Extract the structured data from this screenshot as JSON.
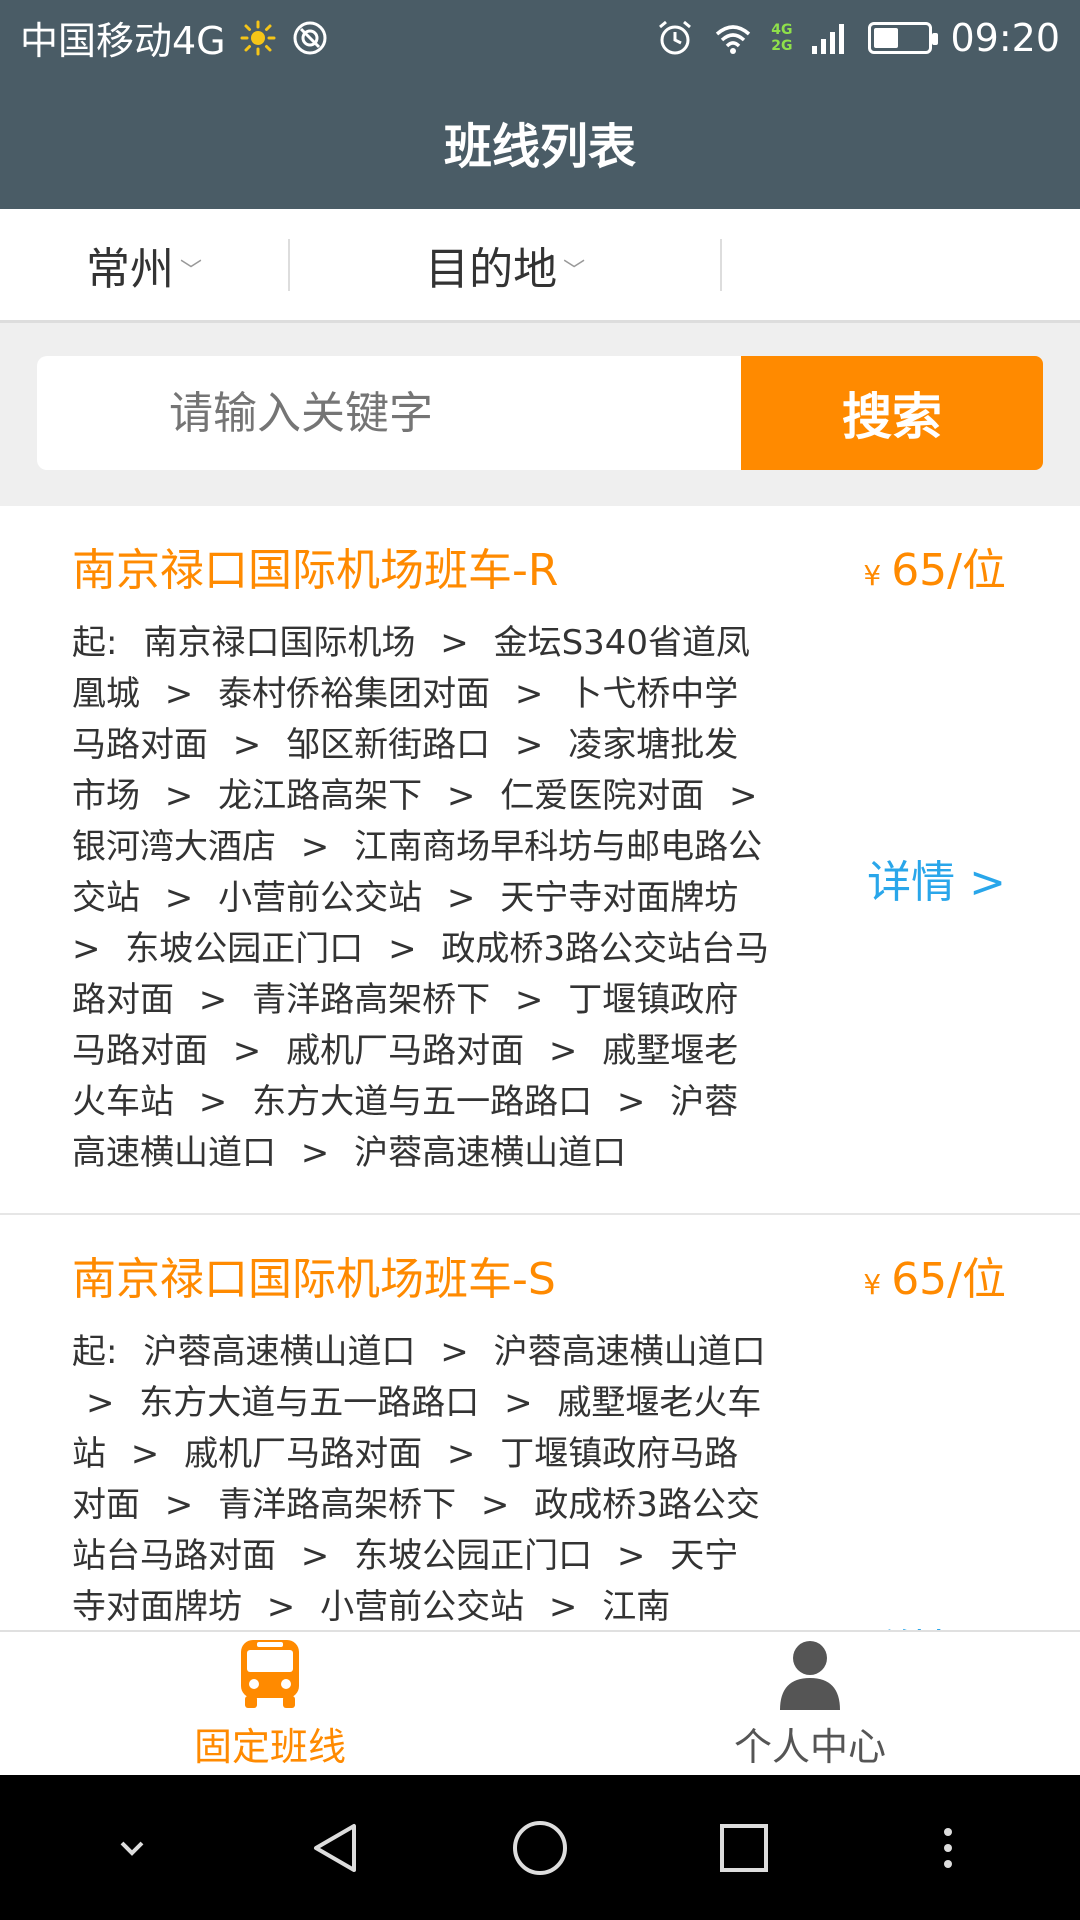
{
  "status_bar": {
    "carrier": "中国移动4G",
    "time": "09:20",
    "net_top": "4G",
    "net_bottom": "2G",
    "battery_level": 0.45,
    "icons": [
      "sun-icon",
      "vpn-icon",
      "alarm-icon",
      "wifi-icon",
      "signal-icon",
      "battery-icon"
    ]
  },
  "header": {
    "title": "班线列表"
  },
  "filters": {
    "origin": "常州",
    "destination": "目的地",
    "third": ""
  },
  "search": {
    "placeholder": "请输入关键字",
    "button_label": "搜索"
  },
  "routes": [
    {
      "title": "南京禄口国际机场班车-R",
      "price_symbol": "¥",
      "price": "65/位",
      "start_label": "起:",
      "stops": [
        "南京禄口国际机场",
        "金坛S340省道凤凰城",
        "泰村侨裕集团对面",
        "卜弋桥中学马路对面",
        "邹区新街路口",
        "凌家塘批发市场",
        "龙江路高架下",
        "仁爱医院对面",
        "银河湾大酒店",
        "江南商场早科坊与邮电路公交站",
        "小营前公交站",
        "天宁寺对面牌坊",
        "东坡公园正门口",
        "政成桥3路公交站台马路对面",
        "青洋路高架桥下",
        "丁堰镇政府马路对面",
        "戚机厂马路对面",
        "戚墅堰老火车站",
        "东方大道与五一路路口",
        "沪蓉高速横山道口",
        "沪蓉高速横山道口"
      ],
      "detail_label": "详情 >"
    },
    {
      "title": "南京禄口国际机场班车-S",
      "price_symbol": "¥",
      "price": "65/位",
      "start_label": "起:",
      "stops": [
        "沪蓉高速横山道口",
        "沪蓉高速横山道口",
        "东方大道与五一路路口",
        "戚墅堰老火车站",
        "戚机厂马路对面",
        "丁堰镇政府马路对面",
        "青洋路高架桥下",
        "政成桥3路公交站台马路对面",
        "东坡公园正门口",
        "天宁寺对面牌坊",
        "小营前公交站",
        "江南"
      ],
      "detail_label": "详情 >"
    }
  ],
  "tabbar": {
    "tabs": [
      {
        "label": "固定班线",
        "icon": "bus-icon",
        "active": true
      },
      {
        "label": "个人中心",
        "icon": "user-icon",
        "active": false
      }
    ],
    "active_color": "#ff8a00"
  },
  "system_nav": [
    "chevron-down-icon",
    "back-icon",
    "home-icon",
    "recents-icon",
    "more-icon"
  ],
  "colors": {
    "header_bg": "#4a5c66",
    "accent": "#ff8a00",
    "link": "#29a6ea"
  }
}
